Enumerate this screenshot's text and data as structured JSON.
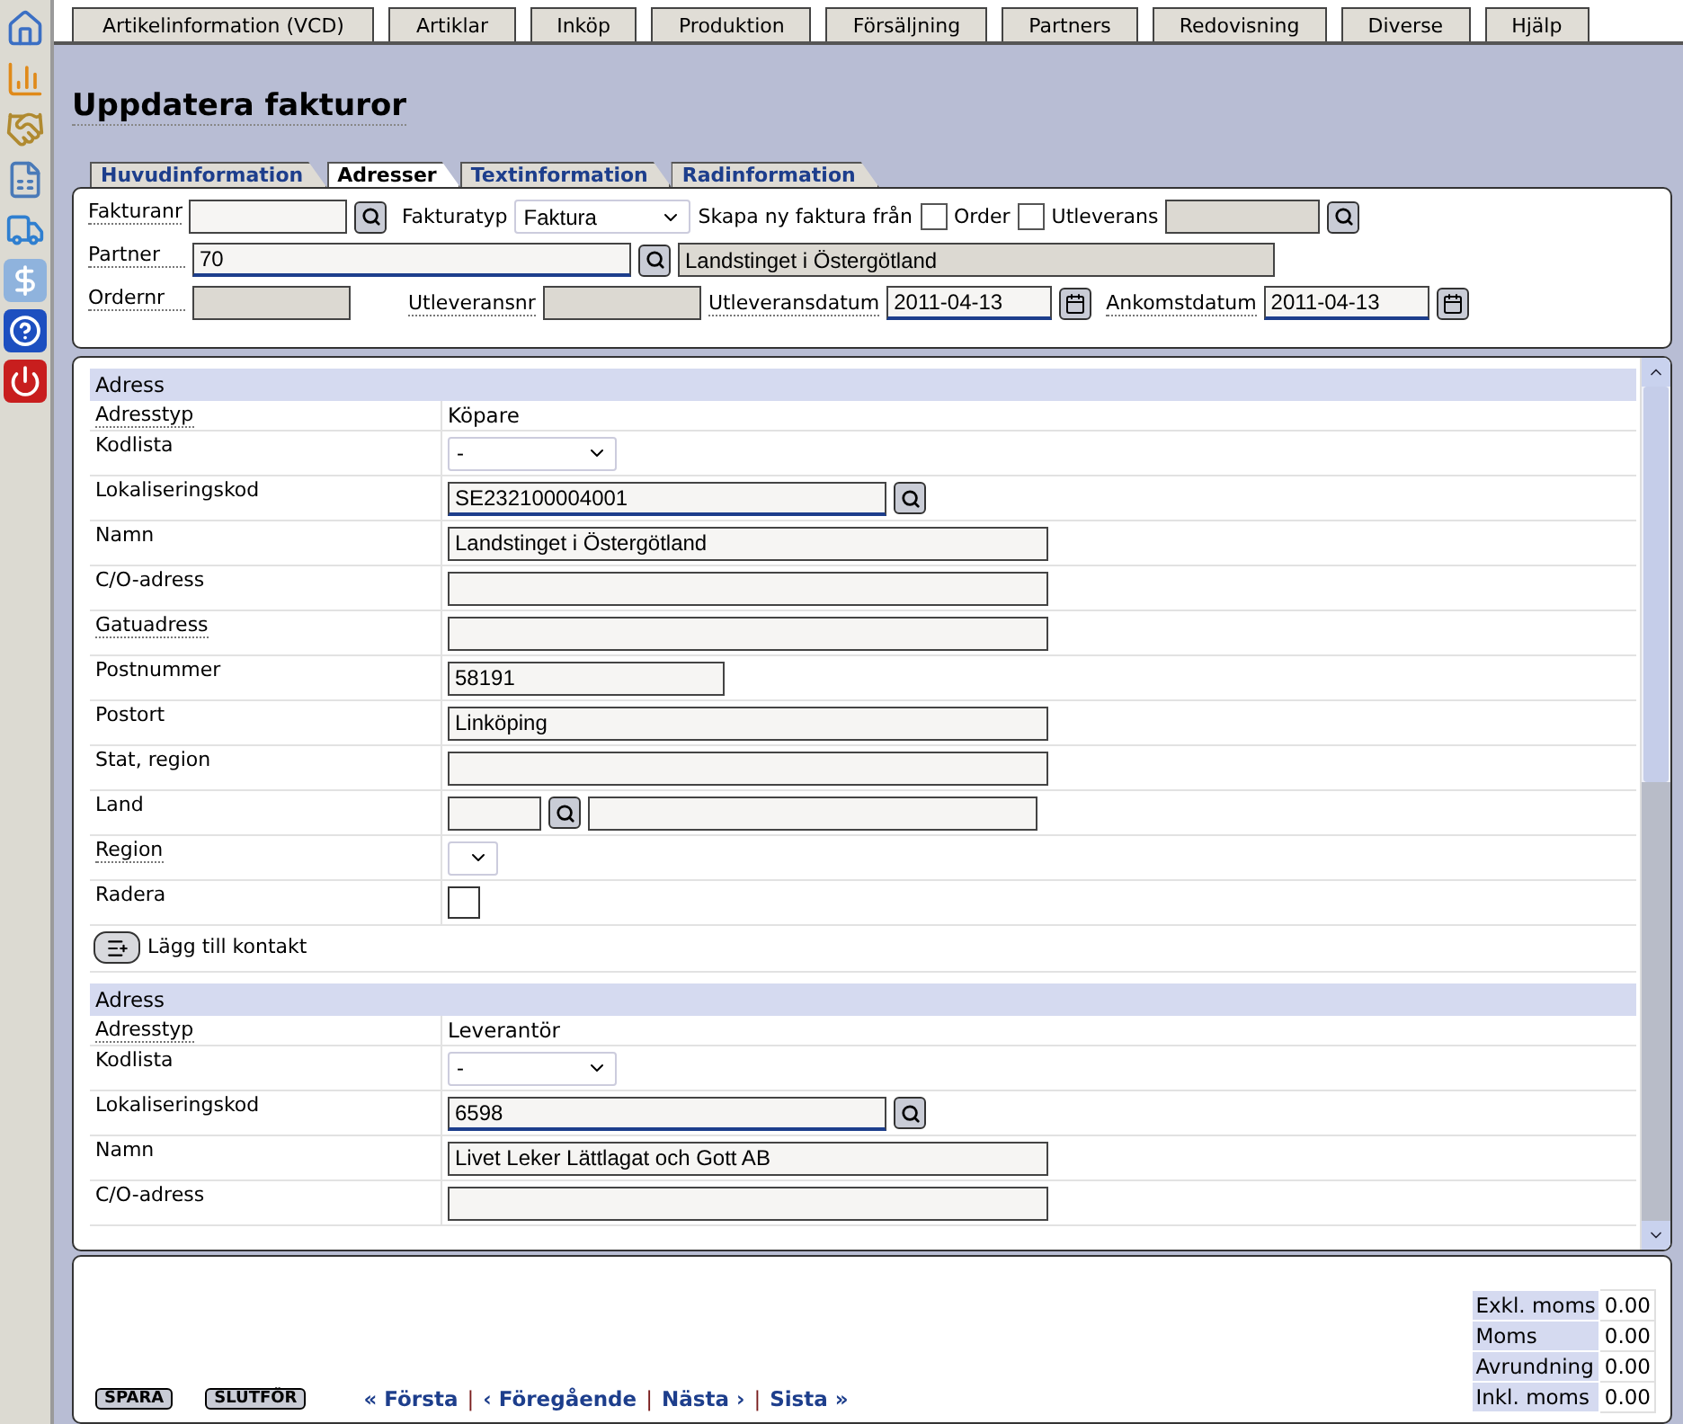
{
  "menu": [
    "Artikelinformation (VCD)",
    "Artiklar",
    "Inköp",
    "Produktion",
    "Försäljning",
    "Partners",
    "Redovisning",
    "Diverse",
    "Hjälp"
  ],
  "title": "Uppdatera fakturor",
  "tabs": [
    {
      "label": "Huvudinformation",
      "selected": false
    },
    {
      "label": "Adresser",
      "selected": true
    },
    {
      "label": "Textinformation",
      "selected": false
    },
    {
      "label": "Radinformation",
      "selected": false
    }
  ],
  "header": {
    "fakturanr": {
      "label": "Fakturanr"
    },
    "fakturatyp": {
      "label": "Fakturatyp",
      "value": "Faktura"
    },
    "skapa_label": "Skapa ny faktura från",
    "sources": [
      {
        "label": "Order",
        "selected": false
      },
      {
        "label": "Utleverans",
        "selected": false
      }
    ],
    "partner": {
      "label": "Partner",
      "value": "70",
      "name": "Landstinget i Östergötland"
    },
    "ordernr": {
      "label": "Ordernr"
    },
    "utleveransnr": {
      "label": "Utleveransnr"
    },
    "utleveransdatum": {
      "label": "Utleveransdatum",
      "value": "2011-04-13"
    },
    "ankomstdatum": {
      "label": "Ankomstdatum",
      "value": "2011-04-13"
    }
  },
  "addresses": [
    {
      "heading": "Adress",
      "add_contact": "Lägg till kontakt",
      "rows": [
        {
          "label": "Adresstyp",
          "help": true,
          "kind": "static",
          "value": "Köpare"
        },
        {
          "label": "Kodlista",
          "help": false,
          "kind": "select",
          "value": "-"
        },
        {
          "label": "Lokaliseringskod",
          "help": false,
          "kind": "lookup",
          "value": "SE232100004001"
        },
        {
          "label": "Namn",
          "help": false,
          "kind": "field",
          "value": "Landstinget i Östergötland"
        },
        {
          "label": "C/O-adress",
          "help": false,
          "kind": "field",
          "value": ""
        },
        {
          "label": "Gatuadress",
          "help": true,
          "kind": "field",
          "value": ""
        },
        {
          "label": "Postnummer",
          "help": false,
          "kind": "short",
          "value": "58191"
        },
        {
          "label": "Postort",
          "help": false,
          "kind": "field",
          "value": "Linköping"
        },
        {
          "label": "Stat, region",
          "help": false,
          "kind": "field",
          "value": ""
        },
        {
          "label": "Land",
          "help": false,
          "kind": "country",
          "value": ""
        },
        {
          "label": "Region",
          "help": true,
          "kind": "tiny-select",
          "value": ""
        },
        {
          "label": "Radera",
          "help": false,
          "kind": "checkbox",
          "checked": false
        }
      ]
    },
    {
      "heading": "Adress",
      "rows": [
        {
          "label": "Adresstyp",
          "help": true,
          "kind": "static",
          "value": "Leverantör"
        },
        {
          "label": "Kodlista",
          "help": false,
          "kind": "select",
          "value": "-"
        },
        {
          "label": "Lokaliseringskod",
          "help": false,
          "kind": "lookup",
          "value": "6598"
        },
        {
          "label": "Namn",
          "help": false,
          "kind": "field",
          "value": "Livet Leker Lättlagat och Gott AB"
        },
        {
          "label": "C/O-adress",
          "help": false,
          "kind": "field",
          "value": ""
        }
      ]
    }
  ],
  "buttons": [
    "SPARA",
    "SLUTFÖR"
  ],
  "pager": [
    "« Första",
    "‹ Föregående",
    "Nästa ›",
    "Sista »"
  ],
  "pager_separator": "|",
  "totals": [
    {
      "label": "Exkl. moms",
      "value": "0.00"
    },
    {
      "label": "Moms",
      "value": "0.00"
    },
    {
      "label": "Avrundning",
      "value": "0.00"
    },
    {
      "label": "Inkl. moms",
      "value": "0.00"
    }
  ]
}
